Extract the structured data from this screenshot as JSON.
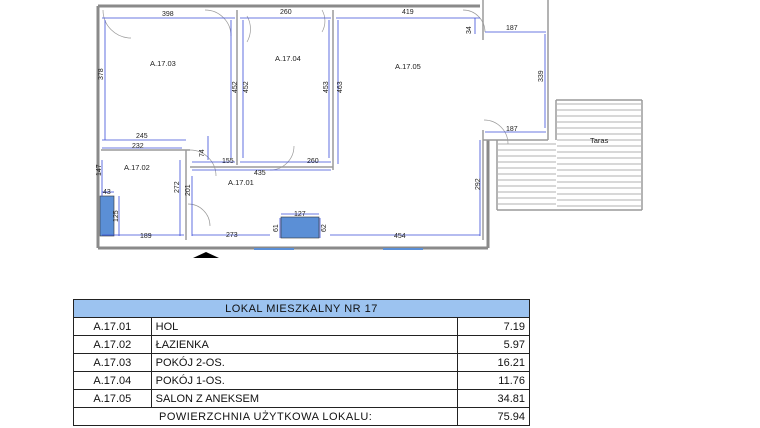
{
  "plan": {
    "rooms": [
      {
        "code": "A.17.03"
      },
      {
        "code": "A.17.04"
      },
      {
        "code": "A.17.05"
      },
      {
        "code": "A.17.02"
      },
      {
        "code": "A.17.01"
      }
    ],
    "terrace_label": "Taras",
    "dimensions": [
      "398",
      "260",
      "419",
      "34",
      "187",
      "378",
      "452",
      "452",
      "453",
      "463",
      "339",
      "187",
      "245",
      "232",
      "74",
      "155",
      "260",
      "147",
      "435",
      "272",
      "201",
      "292",
      "43",
      "125",
      "127",
      "61",
      "62",
      "189",
      "273",
      "454"
    ]
  },
  "table": {
    "title": "LOKAL MIESZKALNY NR 17",
    "rows": [
      {
        "code": "A.17.01",
        "name": "HOL",
        "area": "7.19"
      },
      {
        "code": "A.17.02",
        "name": "ŁAZIENKA",
        "area": "5.97"
      },
      {
        "code": "A.17.03",
        "name": "POKÓJ 2-OS.",
        "area": "16.21"
      },
      {
        "code": "A.17.04",
        "name": "POKÓJ 1-OS.",
        "area": "11.76"
      },
      {
        "code": "A.17.05",
        "name": "SALON Z ANEKSEM",
        "area": "34.81"
      }
    ],
    "total_label": "POWIERZCHNIA UŻYTKOWA LOKALU:",
    "total_value": "75.94"
  },
  "colors": {
    "dimension": "#3a4cd8",
    "fixture": "#5b8fd6",
    "table_header": "#9cc3f0"
  }
}
